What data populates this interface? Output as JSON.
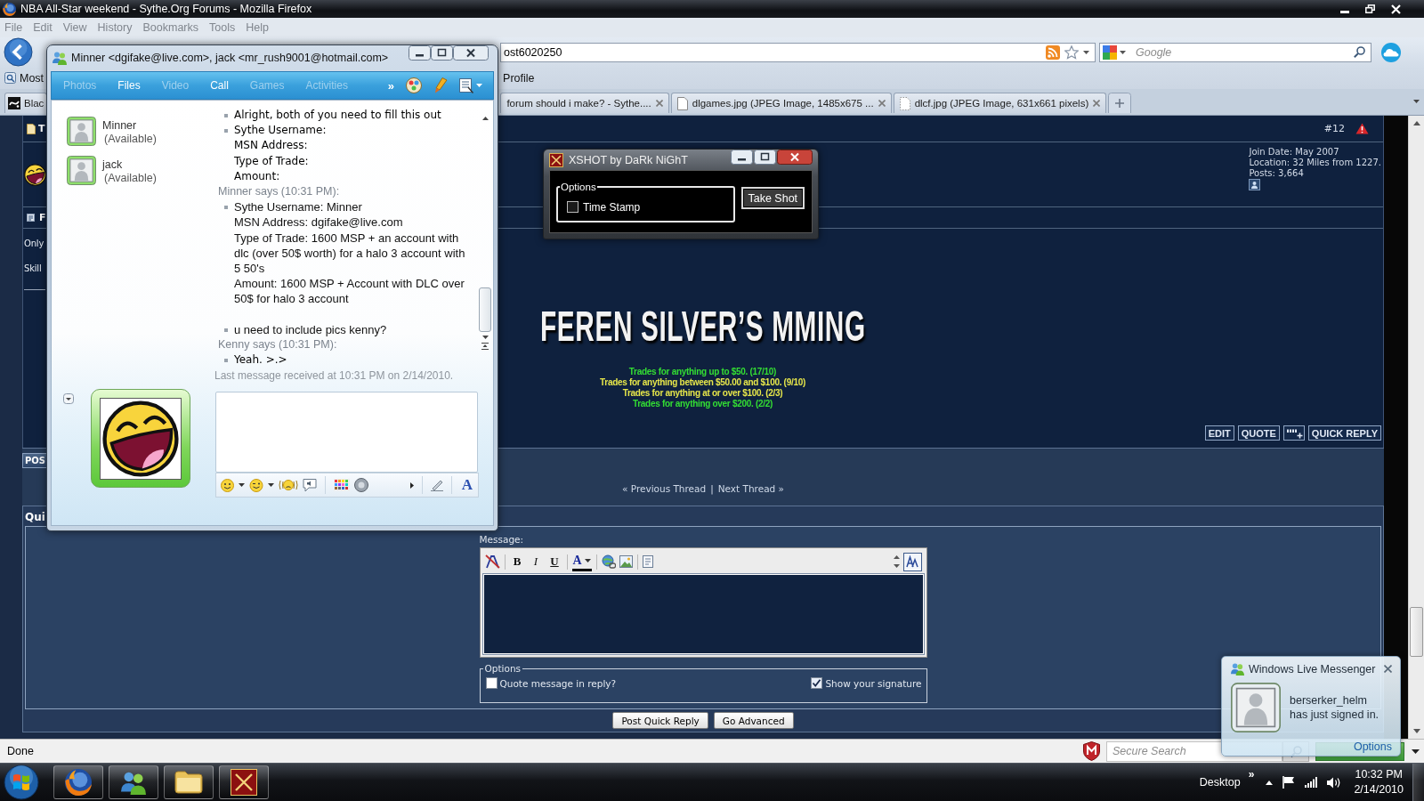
{
  "browser": {
    "title": "NBA All-Star weekend - Sythe.Org Forums - Mozilla Firefox",
    "menu": [
      "File",
      "Edit",
      "View",
      "History",
      "Bookmarks",
      "Tools",
      "Help"
    ],
    "address": "ost6020250",
    "search_placeholder": "Google",
    "bookmarks": [
      "Most",
      "Profile"
    ],
    "tabs": [
      {
        "label": "Blac",
        "selected": false
      },
      {
        "label": "forum should i make? - Sythe....",
        "selected": false
      },
      {
        "label": "dlgames.jpg (JPEG Image, 1485x675 ...",
        "selected": false
      },
      {
        "label": "dlcf.jpg (JPEG Image, 631x661 pixels)",
        "selected": false
      }
    ],
    "status": "Done",
    "secure_search_placeholder": "Secure Search"
  },
  "forum": {
    "post": {
      "title": "T",
      "number": "#12",
      "user_details": [
        "Join Date: May 2007",
        "Location: 32 Miles from 1227.",
        "Posts: 3,664"
      ],
      "heading": "F",
      "message_lines": [
        "Only",
        "Skill"
      ],
      "signature_banner": "FEREN SILVER’S MMING",
      "trade_lines": [
        {
          "text": "Trades for anything up to $50. (17/10)",
          "color": "#33dd33"
        },
        {
          "text": "Trades for anything between $50.00 and $100. (9/10)",
          "color": "#e6e64a"
        },
        {
          "text": "Trades for anything at or over $100. (2/3)",
          "color": "#e6e64a"
        },
        {
          "text": "Trades for anything over $200. (2/2)",
          "color": "#33dd33"
        }
      ],
      "buttons": [
        {
          "kind": "text",
          "label": "EDIT"
        },
        {
          "kind": "text",
          "label": "QUOTE"
        },
        {
          "kind": "multiquote"
        },
        {
          "kind": "text",
          "label": "QUICK REPLY"
        }
      ]
    },
    "reply_button": "POS",
    "thread_nav": {
      "previous": "« Previous Thread",
      "separator": "|",
      "next": "Next Thread »"
    },
    "quick_reply": {
      "title": "Qui",
      "message_label": "Message:",
      "format_buttons": [
        "B",
        "I",
        "U"
      ],
      "font_color": "A",
      "options_legend": "Options",
      "options": [
        {
          "label": "Quote message in reply?",
          "checked": false
        },
        {
          "label": "Show your signature",
          "checked": true
        }
      ],
      "buttons": [
        "Post Quick Reply",
        "Go Advanced"
      ]
    }
  },
  "messenger": {
    "title": "Minner <dgifake@live.com>, jack <mr_rush9001@hotmail.com>",
    "toolbar": [
      {
        "label": "Photos",
        "disabled": true
      },
      {
        "label": "Files",
        "disabled": false
      },
      {
        "label": "Video",
        "disabled": true
      },
      {
        "label": "Call",
        "disabled": false
      },
      {
        "label": "Games",
        "disabled": true
      },
      {
        "label": "Activities",
        "disabled": true
      }
    ],
    "overflow": "»",
    "contacts": [
      {
        "name": "Minner",
        "status": "(Available)"
      },
      {
        "name": "jack",
        "status": "(Available)"
      }
    ],
    "conversation": [
      {
        "kind": "message",
        "handwritten": true,
        "blank_after": false,
        "lines": [
          "Alright, both of you need to fill this out"
        ]
      },
      {
        "kind": "message",
        "handwritten": true,
        "blank_after": false,
        "lines": [
          "Sythe Username:",
          "MSN Address:",
          "Type of Trade:",
          "Amount:"
        ]
      },
      {
        "kind": "sender",
        "text": "Minner says (10:31 PM):"
      },
      {
        "kind": "message",
        "handwritten": false,
        "blank_after": true,
        "lines": [
          "Sythe Username: Minner",
          "MSN Address: dgifake@live.com",
          "Type of Trade: 1600 MSP + an account with dlc (over 50$ worth) for a halo 3 account with 5 50's",
          "Amount: 1600 MSP + Account with DLC over 50$ for halo 3 account"
        ]
      },
      {
        "kind": "message",
        "handwritten": false,
        "blank_after": false,
        "lines": [
          "u need to include pics kenny?"
        ]
      },
      {
        "kind": "sender",
        "text": "Kenny says (10:31 PM):"
      },
      {
        "kind": "message",
        "handwritten": true,
        "blank_after": false,
        "lines": [
          "Yeah. >.>"
        ]
      }
    ],
    "last_message": "Last message received at 10:31 PM on 2/14/2010.",
    "font_button": "A"
  },
  "xshot": {
    "title": "XSHOT by DaRk NiGhT",
    "options_legend": "Options",
    "time_stamp": {
      "label": "Time Stamp",
      "checked": false
    },
    "button": "Take Shot"
  },
  "notification": {
    "title": "Windows Live Messenger",
    "message": "berserker_helm\nhas just signed in.",
    "link": "Options"
  },
  "taskbar": {
    "desktop_label": "Desktop",
    "overflow": "»",
    "time": "10:32 PM",
    "date": "2/14/2010"
  }
}
